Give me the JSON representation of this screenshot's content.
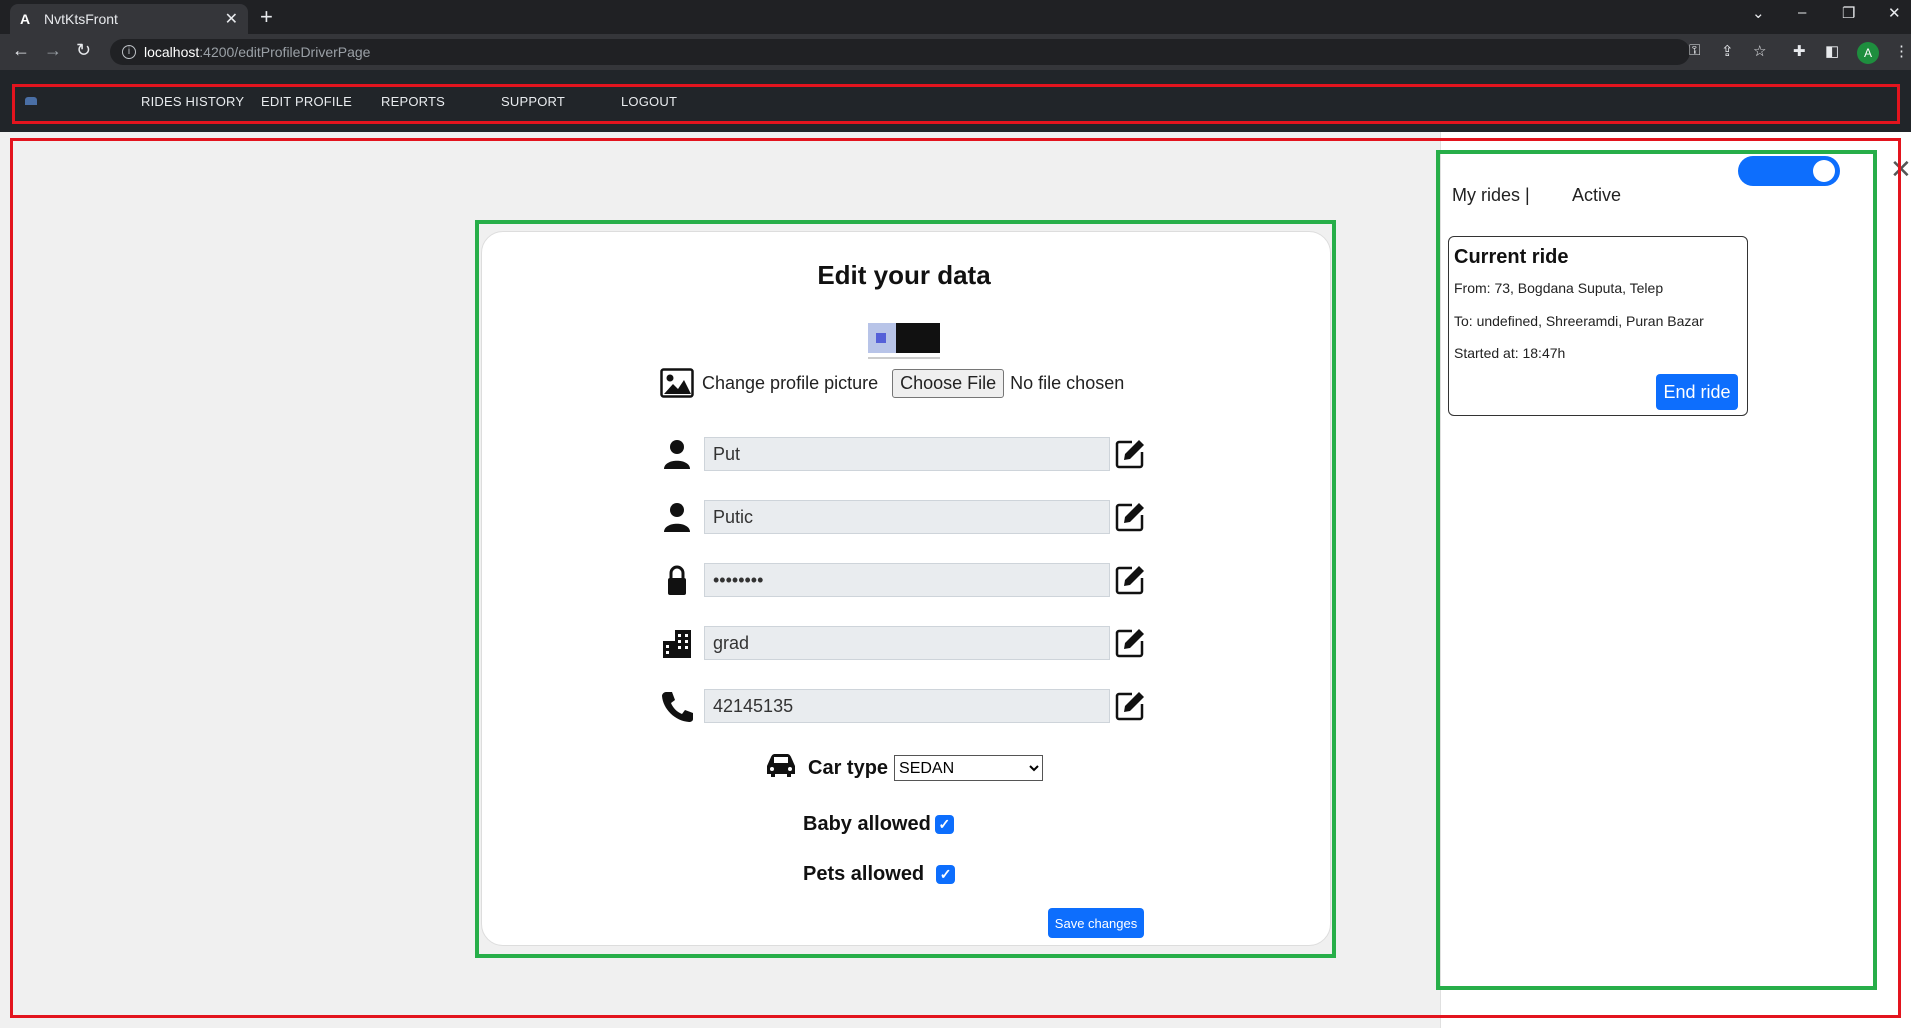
{
  "browser": {
    "tab_title": "NvtKtsFront",
    "tab_favicon": "A",
    "url_host": "localhost",
    "url_path": ":4200/editProfileDriverPage",
    "profile_initial": "A"
  },
  "nav": {
    "items": [
      "RIDES HISTORY",
      "EDIT PROFILE",
      "REPORTS",
      "SUPPORT",
      "LOGOUT"
    ]
  },
  "form": {
    "title": "Edit your data",
    "change_picture_label": "Change profile picture",
    "choose_file_label": "Choose File",
    "no_file_label": "No file chosen",
    "fields": [
      {
        "icon": "person-icon",
        "value": "Put"
      },
      {
        "icon": "person-icon",
        "value": "Putic"
      },
      {
        "icon": "lock-icon",
        "value": "••••••••"
      },
      {
        "icon": "building-icon",
        "value": "grad"
      },
      {
        "icon": "phone-icon",
        "value": "42145135"
      }
    ],
    "car_type_label": "Car type",
    "car_type_value": "SEDAN",
    "baby_allowed_label": "Baby allowed",
    "baby_allowed": true,
    "pets_allowed_label": "Pets allowed",
    "pets_allowed": true,
    "save_label": "Save changes"
  },
  "sidebar": {
    "my_rides_label": "My rides |",
    "active_label": "Active",
    "toggle_on": true,
    "current_ride": {
      "title": "Current ride",
      "from": "From: 73, Bogdana Suputa, Telep",
      "to": "To: undefined, Shreeramdi, Puran Bazar",
      "started": "Started at: 18:47h",
      "end_label": "End ride"
    }
  },
  "colors": {
    "accent": "#0d6efd",
    "nav_bg": "#212529",
    "highlight_red": "#e3141e",
    "highlight_green": "#27ae49"
  }
}
